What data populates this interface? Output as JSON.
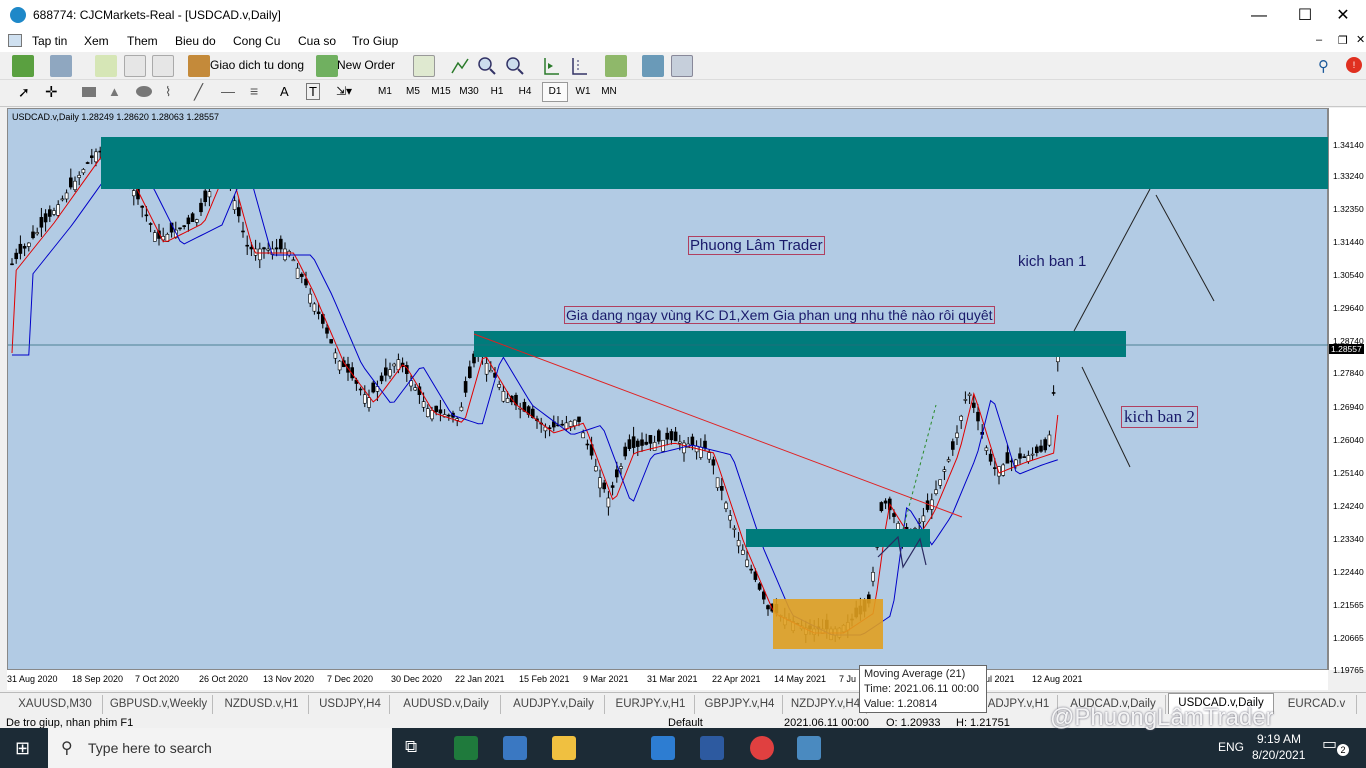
{
  "window": {
    "title": "688774: CJCMarkets-Real - [USDCAD.v,Daily]",
    "minimize": "—",
    "maximize": "☐",
    "close": "✕"
  },
  "menu": [
    "Tap tin",
    "Xem",
    "Them",
    "Bieu do",
    "Cong Cu",
    "Cua so",
    "Tro Giup"
  ],
  "toolbar": {
    "auto_trading_label": "Giao dich tu dong",
    "new_order_label": "New Order"
  },
  "timeframes": [
    "M1",
    "M5",
    "M15",
    "M30",
    "H1",
    "H4",
    "D1",
    "W1",
    "MN"
  ],
  "active_timeframe": "D1",
  "chart": {
    "header": "USDCAD.v,Daily  1.28249 1.28620 1.28063 1.28557",
    "price_labels": [
      "1.34140",
      "1.33240",
      "1.32350",
      "1.31440",
      "1.30540",
      "1.29640",
      "1.28740",
      "1.28557",
      "1.27840",
      "1.26940",
      "1.26040",
      "1.25140",
      "1.24240",
      "1.23340",
      "1.22440",
      "1.21565",
      "1.20665",
      "1.19765"
    ],
    "current_price": "1.28557",
    "date_labels": [
      "31 Aug 2020",
      "18 Sep 2020",
      "7 Oct 2020",
      "26 Oct 2020",
      "13 Nov 2020",
      "7 Dec 2020",
      "30 Dec 2020",
      "22 Jan 2021",
      "15 Feb 2021",
      "9 Mar 2021",
      "31 Mar 2021",
      "22 Apr 2021",
      "14 May 2021",
      "7 Ju",
      "ul 2021",
      "12 Aug 2021"
    ],
    "annotations": {
      "brand": "Phuong Lâm Trader",
      "note": "Gia dang ngay vùng KC D1,Xem Gia phan ung nhu thê nào rôi quyêt",
      "scenario1": "kich ban 1",
      "scenario2": "kich ban 2"
    },
    "colors": {
      "background": "#b2cbe4",
      "zone": "#007c7c",
      "accumulation": "#e0a020",
      "ma_fast": "#e00000",
      "ma_slow": "#0000c8"
    }
  },
  "tooltip": {
    "line1": "Moving Average (21)",
    "line2": "Time: 2021.06.11 00:00",
    "line3": "Value: 1.20814"
  },
  "tabs": [
    "XAUUSD,M30",
    "GBPUSD.v,Weekly",
    "NZDUSD.v,H1",
    "USDJPY,H4",
    "AUDUSD.v,Daily",
    "AUDJPY.v,Daily",
    "EURJPY.v,H1",
    "GBPJPY.v,H4",
    "NZDJPY.v,H4",
    "ADJPY.v,H1",
    "AUDCAD.v,Daily",
    "USDCAD.v,Daily",
    "EURCAD.v"
  ],
  "active_tab": "USDCAD.v,Daily",
  "status": {
    "help": "De tro giup, nhan phim F1",
    "profile": "Default",
    "time": "2021.06.11 00:00",
    "open": "O: 1.20933",
    "high": "H: 1.21751",
    "watermark": "@PhuongLâmTrader"
  },
  "taskbar": {
    "search_placeholder": "Type here to search",
    "lang": "ENG",
    "time": "9:19 AM",
    "date": "8/20/2021",
    "notif_count": "2"
  }
}
